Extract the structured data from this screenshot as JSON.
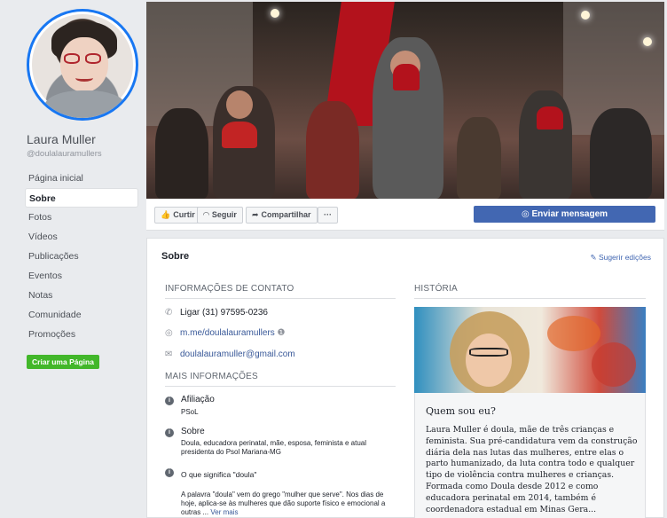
{
  "profile": {
    "name": "Laura Muller",
    "handle": "@doulalauramullers"
  },
  "nav": [
    {
      "label": "Página inicial",
      "active": false
    },
    {
      "label": "Sobre",
      "active": true
    },
    {
      "label": "Fotos",
      "active": false
    },
    {
      "label": "Vídeos",
      "active": false
    },
    {
      "label": "Publicações",
      "active": false
    },
    {
      "label": "Eventos",
      "active": false
    },
    {
      "label": "Notas",
      "active": false
    },
    {
      "label": "Comunidade",
      "active": false
    },
    {
      "label": "Promoções",
      "active": false
    }
  ],
  "create_page_label": "Criar uma Página",
  "actions": {
    "like": "Curtir",
    "follow": "Seguir",
    "share": "Compartilhar",
    "more": "···",
    "send_message": "Enviar mensagem"
  },
  "about": {
    "title": "Sobre",
    "suggest_edits": "Sugerir edições",
    "contact_header": "INFORMAÇÕES DE CONTATO",
    "phone": "Ligar (31) 97595-0236",
    "messenger": "m.me/doulalauramullers",
    "email": "doulalauramuller@gmail.com",
    "more_header": "MAIS INFORMAÇÕES",
    "affiliation_title": "Afiliação",
    "affiliation_value": "PSoL",
    "about_title": "Sobre",
    "about_value": "Doula, educadora perinatal, mãe, esposa, feminista e atual presidenta do Psol Mariana-MG",
    "doula_title": "O que significa \"doula\"",
    "doula_value": "A palavra \"doula\" vem do grego \"mulher que serve\". Nos dias de hoje, aplica-se às mulheres que dão suporte físico e emocional a outras ...",
    "see_more": "Ver mais"
  },
  "story": {
    "header": "HISTÓRIA",
    "question": "Quem sou eu?",
    "text": "Laura Muller é doula, mãe de três crianças e feminista. Sua pré-candidatura vem da construção diária dela nas lutas das mulheres, entre elas o parto humanizado, da luta contra todo e qualquer tipo de violência contra mulheres e crianças. Formada como Doula desde 2012 e como educadora perinatal em 2014, também é coordenadora estadual em Minas Gera..."
  },
  "colors": {
    "brand_blue": "#4267b2",
    "green": "#42b72a",
    "avatar_ring": "#1877f2"
  }
}
